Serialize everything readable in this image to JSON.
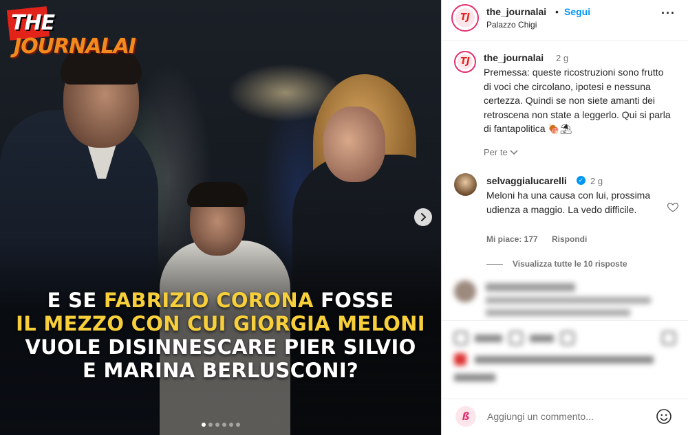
{
  "post": {
    "logo": {
      "the": "THE",
      "journal": "JOURNALAI"
    },
    "headline": {
      "line1_pre": "E SE ",
      "line1_hl": "FABRIZIO CORONA",
      "line1_post": " FOSSE",
      "line2_hl": "IL MEZZO CON CUI GIORGIA MELONI",
      "line3": "VUOLE DISINNESCARE PIER SILVIO",
      "line4": "E MARINA BERLUSCONI?"
    },
    "carousel": {
      "count": 6,
      "active_index": 0
    },
    "highlight_color": "#f6cf3a"
  },
  "header": {
    "username": "the_journalai",
    "separator": "•",
    "follow_label": "Segui",
    "location": "Palazzo Chigi",
    "avatar_initials": "TJ",
    "more_icon": "ellipsis-icon"
  },
  "caption": {
    "username": "the_journalai",
    "time": "2 g",
    "text": "Premessa: queste ricostruzioni sono frutto di voci  che circolano, ipotesi e nessuna certezza. Quindi se non siete amanti dei retroscena non state a leggerlo. Qui si parla di fantapolitica 🍖⛱",
    "for_you_label": "Per te"
  },
  "comment": {
    "username": "selvaggialucarelli",
    "verified_icon": "verified-badge-icon",
    "time": "2 g",
    "text": "Meloni ha una causa con lui, prossima udienza a maggio. La vedo difficile.",
    "likes_label": "Mi piace: 177",
    "reply_label": "Rispondi",
    "view_replies_label": "Visualizza tutte le 10 risposte"
  },
  "add_comment": {
    "placeholder": "Aggiungi un commento...",
    "avatar_glyph": "ß"
  },
  "colors": {
    "accent_blue": "#0095f6",
    "brand_pink": "#e52e6e",
    "brand_red": "#e2231a",
    "logo_orange": "#f28a1e"
  }
}
